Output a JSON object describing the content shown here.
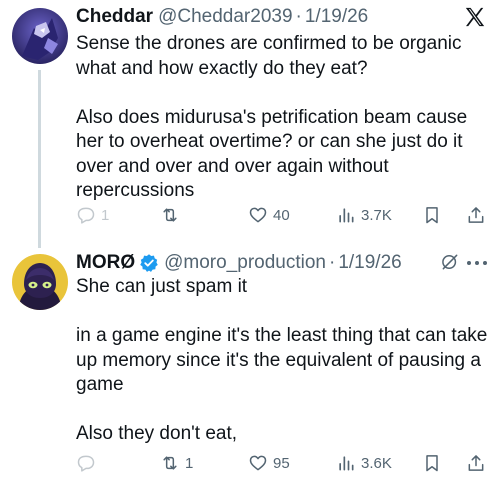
{
  "tweets": [
    {
      "author": "Cheddar",
      "handle": "@Cheddar2039",
      "date": "1/19/26",
      "text": "Sense the drones are confirmed to be organic\nwhat and how exactly do they eat?\n\nAlso does midurusa's petrification beam cause\nher to overheat overtime? or can she just do it\nover and over and over again without\nrepercussions",
      "reply_count": "1",
      "retweet_count": "",
      "like_count": "40",
      "view_count": "3.7K"
    },
    {
      "author": "MORØ",
      "handle": "@moro_production",
      "date": "1/19/26",
      "text": "She can just spam it\n\nin a game engine it's the least thing that can take\nup memory since it's the equivalent of pausing a\ngame\n\nAlso they don't eat,",
      "reply_count": "",
      "retweet_count": "1",
      "like_count": "95",
      "view_count": "3.6K"
    }
  ],
  "separator": "·",
  "icons": {
    "platform": "x-logo-icon",
    "verified": "verified-badge-icon",
    "reply": "reply-icon",
    "retweet": "retweet-icon",
    "like": "heart-icon",
    "views": "views-bar-chart-icon",
    "bookmark": "bookmark-icon",
    "share": "share-icon",
    "grok": "grok-icon",
    "more": "more-dots-icon"
  },
  "colors": {
    "text": "#0f1419",
    "secondary": "#536471",
    "verified": "#1d9bf0",
    "thread_line": "#cfd9de"
  }
}
